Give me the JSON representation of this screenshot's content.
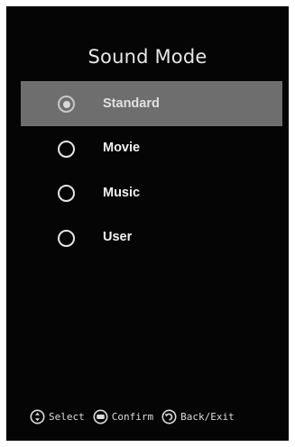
{
  "title": "Sound Mode",
  "options": [
    {
      "label": "Standard",
      "checked": true
    },
    {
      "label": "Movie",
      "checked": false
    },
    {
      "label": "Music",
      "checked": false
    },
    {
      "label": "User",
      "checked": false
    }
  ],
  "footer": {
    "select_icon": "up-down-arrows-icon",
    "select_label": "Select",
    "confirm_icon": "ok-button-icon",
    "confirm_label": "Confirm",
    "back_icon": "back-arrow-icon",
    "back_label": "Back/Exit"
  },
  "colors": {
    "background": "#050505",
    "highlight": "#6e6e6e",
    "text": "#f0f0f0"
  }
}
